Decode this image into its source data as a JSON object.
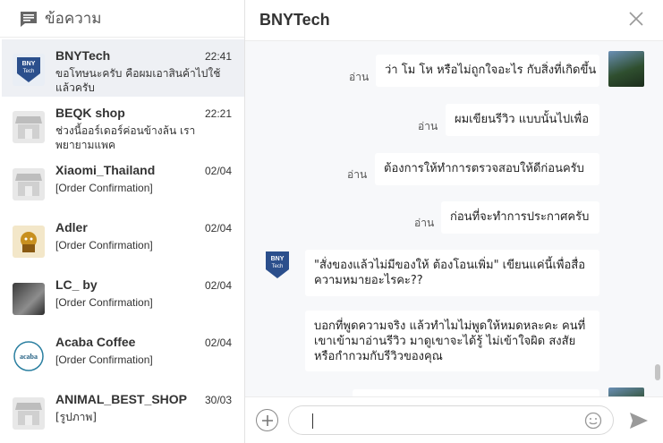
{
  "sidebar": {
    "title": "ข้อความ",
    "conversations": [
      {
        "name": "BNYTech",
        "time": "22:41",
        "preview": "ขอโทษนะครับ คือผมเอาสินค้าไปใช้แล้วครับ",
        "avatar": "bnytech-logo"
      },
      {
        "name": "BEQK shop",
        "time": "22:21",
        "preview": "ช่วงนี้ออร์เดอร์ค่อนข้างล้น เราพยายามแพค",
        "avatar": "shop-placeholder"
      },
      {
        "name": "Xiaomi_Thailand",
        "time": "02/04",
        "preview": "[Order Confirmation]",
        "avatar": "shop-placeholder"
      },
      {
        "name": "Adler",
        "time": "02/04",
        "preview": "[Order Confirmation]",
        "avatar": "adler-logo"
      },
      {
        "name": "LC_ by",
        "time": "02/04",
        "preview": "[Order Confirmation]",
        "avatar": "photo"
      },
      {
        "name": "Acaba Coffee",
        "time": "02/04",
        "preview": "[Order Confirmation]",
        "avatar": "acaba-logo"
      },
      {
        "name": "ANIMAL_BEST_SHOP",
        "time": "30/03",
        "preview": "[รูปภาพ]",
        "avatar": "shop-placeholder"
      }
    ]
  },
  "chat": {
    "title": "BNYTech",
    "read_label": "อ่าน",
    "messages": [
      {
        "from": "me",
        "text": "ว่า โม โห หรือไม่ถูกใจอะไร กับสิ่งที่เกิดขึ้น",
        "read": true
      },
      {
        "from": "me",
        "text": "ผมเขียนรีวิว แบบนั้นไปเพื่อ",
        "read": true
      },
      {
        "from": "me",
        "text": "ต้องการให้ทำการตรวจสอบให้ดีก่อนครับ",
        "read": true
      },
      {
        "from": "me",
        "text": "ก่อนที่จะทำการประกาศครับ",
        "read": true
      },
      {
        "from": "shop",
        "text": "\"สั่งของแล้วไม่มีของให้ ต้องโอนเพิ่ม\" เขียนแค่นี้เพื่อสื่อความหมายอะไรคะ??"
      },
      {
        "from": "shop",
        "text": "บอกที่พูดความจริง แล้วทำไมไม่พูดให้หมดหละคะ คนที่เขาเข้ามาอ่านรีวิว มาดูเขาจะได้รู้ ไม่เข้าใจผิด สงสัยหรือกำกวมกับรีวิวของคุณ"
      }
    ]
  },
  "colors": {
    "active_row": "#eef0f4",
    "chat_bg": "#f7f8fa",
    "brand_blue": "#2b4f8c"
  }
}
